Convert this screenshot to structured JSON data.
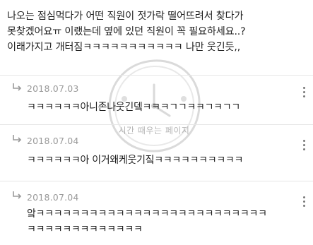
{
  "post": {
    "lines": [
      "나오는 점심먹다가 어떤 직원이 젓가락 떨어뜨려서 찾다가",
      "못찾겠어요ㅠ 이랬는데 옆에 있던 직원이 꼭 필요하세요..?",
      "이래가지고 개터짐ㅋㅋㅋㅋㅋㅋㅋㅋㅋㅋㅋ 나만 웃긴듯,,"
    ]
  },
  "watermark": {
    "text": "시간 때우는 페이지"
  },
  "replies": [
    {
      "date": "2018.07.03",
      "lines": [
        "ㅋㅋㅋㅋㅋㅋ아니존나웃긴뎈ㅋㅋㅋㄱㄱㅋㅋㄱㅋㄱㄱ"
      ]
    },
    {
      "date": "2018.07.04",
      "lines": [
        "ㅋㅋㅋㅋㅋㅋ아 이거왜케웃기짘ㅋㅋㅋㅋㅋㅋㅋㅋㅋㅋ"
      ]
    },
    {
      "date": "2018.07.04",
      "lines": [
        "앜ㅋㅋㅋㅋㅋㅋㅋㅋㅋㅋㅋㅋㅋㅋㅋㅋㅋㅋㅋㅋㅋㅋㅋㅋㅋㅋ",
        "ㅋㅋㅋㅋㅋㅋㅋㅋㅋㅋㅋㅋㅋ"
      ]
    }
  ],
  "icons": {
    "reply": "reply-arrow-icon",
    "more": "more-vertical-icon"
  },
  "colors": {
    "text": "#1f1f1f",
    "date": "#9a9a9a",
    "divider": "#e6e6e6",
    "icon": "#777777"
  }
}
